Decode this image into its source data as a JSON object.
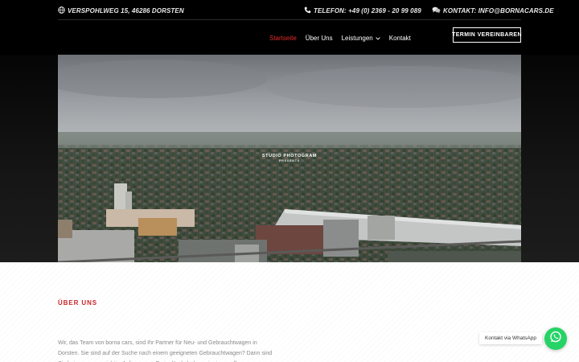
{
  "topbar": {
    "address": "VERSPOHLWEG 15, 46286 DORSTEN",
    "phone": "TELEFON: +49 (0) 2369 - 20 99 089",
    "email": "KONTAKT: INFO@BORNACARS.DE"
  },
  "nav": {
    "items": [
      {
        "label": "Startseite",
        "active": true
      },
      {
        "label": "Über Uns"
      },
      {
        "label": "Leistungen",
        "has_dropdown": true
      },
      {
        "label": "Kontakt"
      }
    ],
    "cta_label": "TERMIN VEREINBAREN"
  },
  "hero": {
    "video_title": "STUDIO PHOTOGRAM",
    "video_subtitle": "PRESENTS"
  },
  "about": {
    "title": "ÜBER UNS",
    "text": "Wir, das Team von borna cars, sind Ihr Partner für Neu- und Gebrauchtwagen in Dorsten. Sie sind auf der Suche nach einem geeigneten Gebrauchtwagen? Dann sind Sie bei uns genau richtig. Auf unserem Freigelände haben wir eine große"
  },
  "whatsapp": {
    "label": "Kontakt via WhatsApp"
  },
  "colors": {
    "accent": "#e52b2b",
    "section_title": "#c9252b",
    "whatsapp": "#25d366",
    "header_bg": "#000000"
  },
  "icons": {
    "address": "globe-icon",
    "phone": "phone-icon",
    "email": "chat-bubbles-icon",
    "dropdown": "chevron-down-icon",
    "whatsapp": "whatsapp-icon"
  }
}
